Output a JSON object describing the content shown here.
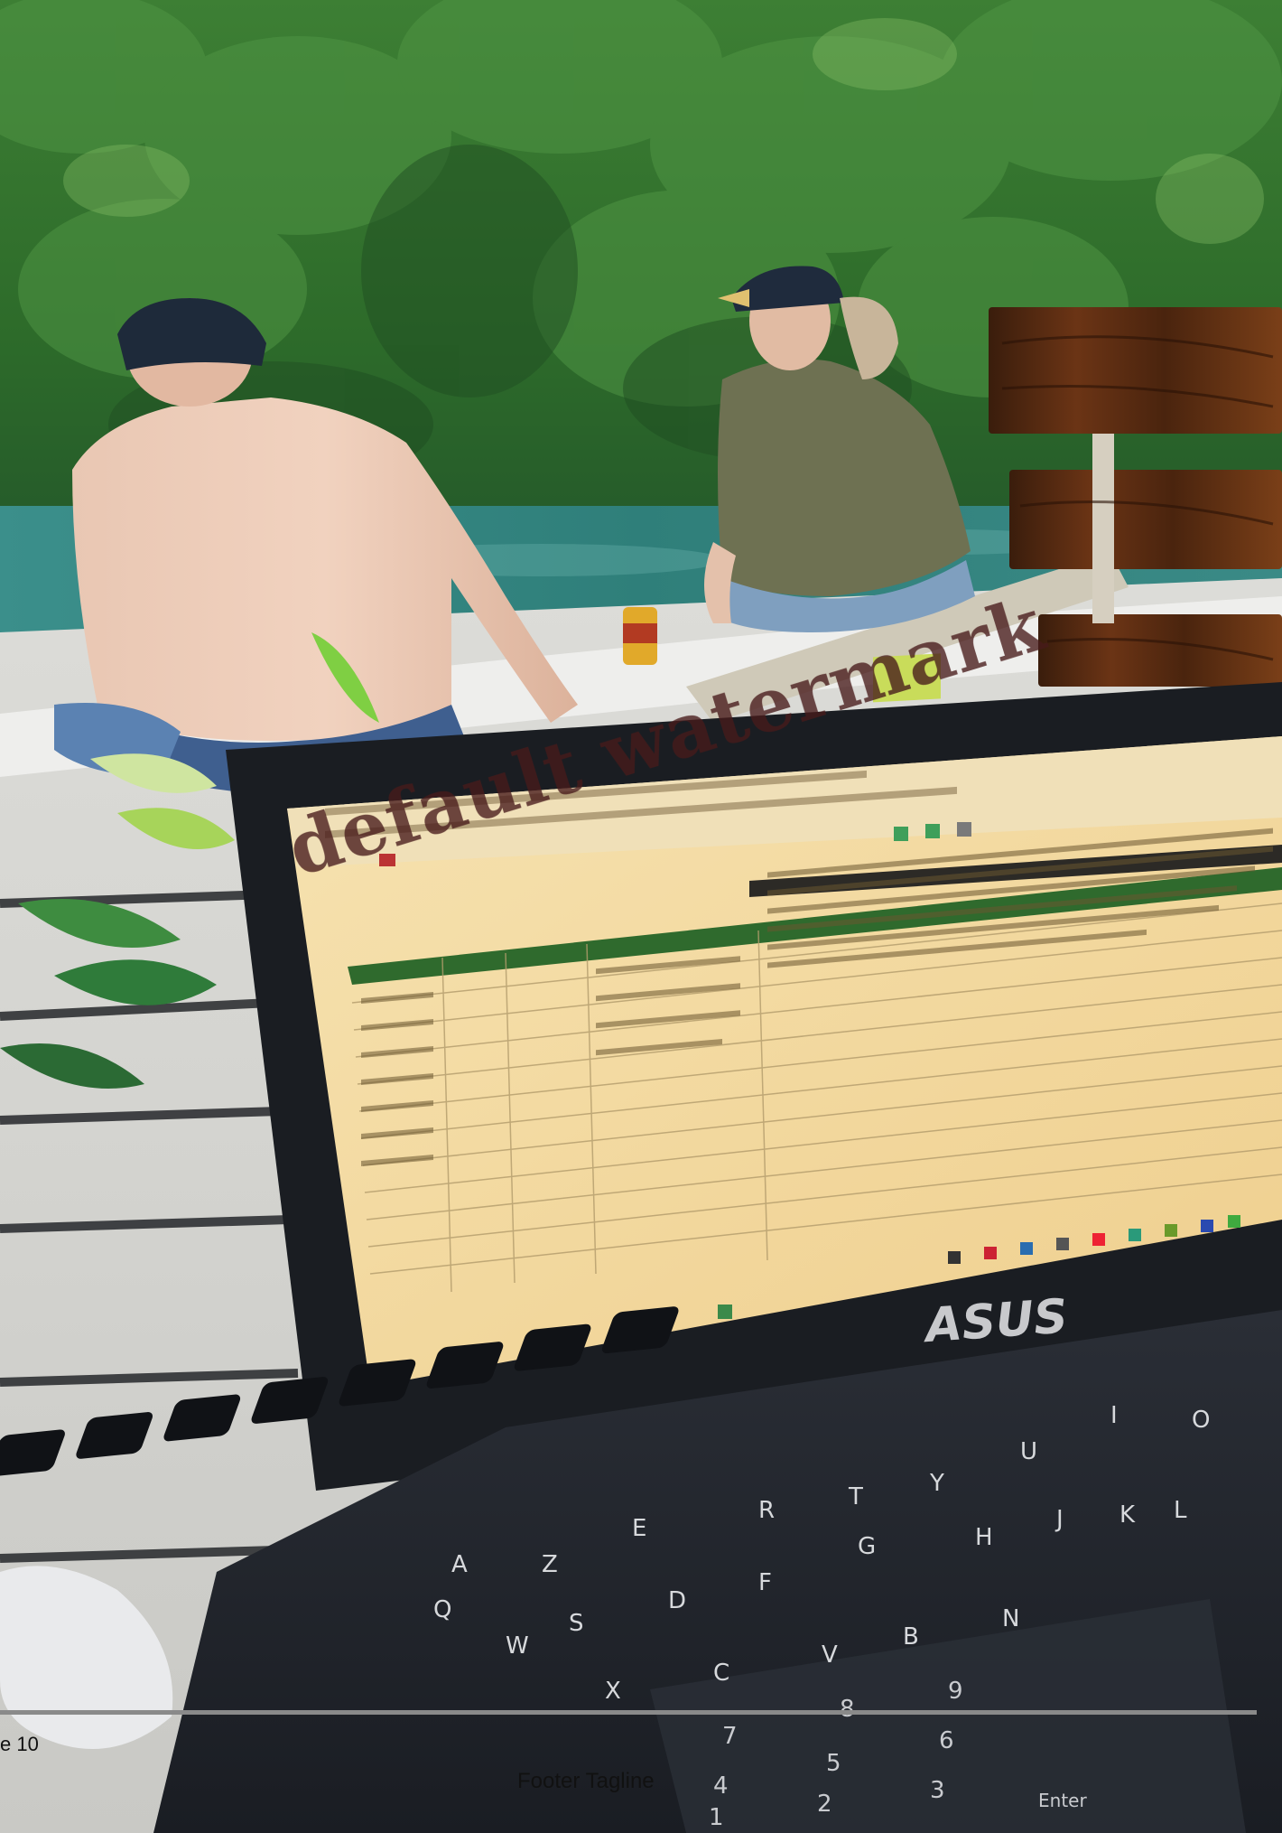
{
  "watermark": "default watermark",
  "laptop_brand": "ASUS",
  "footer": {
    "page_label": "e 10",
    "tagline": "Footer Tagline"
  },
  "keyboard_letters": [
    "T",
    "Y",
    "U",
    "I",
    "O",
    "R",
    "E",
    "G",
    "H",
    "J",
    "K",
    "L",
    "F",
    "D",
    "S",
    "Z",
    "C",
    "V",
    "B",
    "N",
    "W",
    "Q",
    "A",
    "X"
  ],
  "numpad_labels": [
    "7",
    "8",
    "9",
    "4",
    "5",
    "6",
    "1",
    "2",
    "3",
    "Enter"
  ],
  "colors": {
    "foliage": "#2f6f2a",
    "water": "#3c8a86",
    "laptop_bezel": "#1c1f24",
    "screen": "#f3dca6",
    "sheet_header": "#2f6a2d",
    "footer_rule": "#8a8a8a"
  }
}
